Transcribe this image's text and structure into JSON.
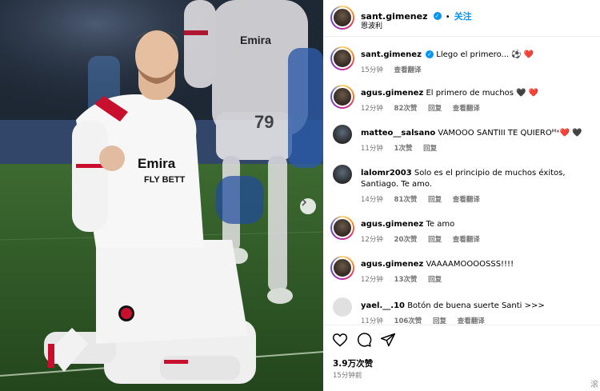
{
  "post": {
    "author": "sant.gimenez",
    "follow_label": "关注",
    "location": "恩波利",
    "likes": "3.9万次赞",
    "time_ago": "15分钟前",
    "corner_mark": "滚"
  },
  "photo": {
    "shirt_sponsor": "Emirates FLY BETTER",
    "carousel_icon": "chevron-right-icon"
  },
  "comments": [
    {
      "user": "sant.gimenez",
      "verified": true,
      "text": "Llego el primero... ⚽ ❤️",
      "time": "15分钟",
      "likes": "",
      "reply": "",
      "translate": "查看翻译"
    },
    {
      "user": "agus.gimenez",
      "verified": false,
      "text": "El primero de muchos 🖤 ❤️",
      "time": "12分钟",
      "likes": "82次赞",
      "reply": "回复",
      "translate": "查看翻译"
    },
    {
      "user": "matteo__salsano",
      "verified": false,
      "text": "VAMOOO SANTIII TE QUIEROᴹˣ❤️ 🖤",
      "time": "11分钟",
      "likes": "1次赞",
      "reply": "回复",
      "translate": ""
    },
    {
      "user": "lalomr2003",
      "verified": false,
      "text": "Solo es el principio de muchos éxitos, Santiago. Te amo.",
      "time": "14分钟",
      "likes": "81次赞",
      "reply": "回复",
      "translate": "查看翻译"
    },
    {
      "user": "agus.gimenez",
      "verified": false,
      "text": "Te amo",
      "time": "12分钟",
      "likes": "20次赞",
      "reply": "回复",
      "translate": "查看翻译"
    },
    {
      "user": "agus.gimenez",
      "verified": false,
      "text": "VAAAAMOOOOSSS!!!!",
      "time": "12分钟",
      "likes": "13次赞",
      "reply": "回复",
      "translate": ""
    },
    {
      "user": "yael.__.10",
      "verified": false,
      "text": "Botón de buena suerte Santi >>>",
      "time": "11分钟",
      "likes": "106次赞",
      "reply": "回复",
      "translate": "查看翻译"
    }
  ],
  "actions": {
    "like_icon": "heart-icon",
    "comment_icon": "comment-icon",
    "share_icon": "share-icon"
  },
  "colors": {
    "accent": "#0095f6",
    "heart_red": "#ed4956",
    "meta_grey": "#737373",
    "jersey_red": "#c8102e"
  }
}
